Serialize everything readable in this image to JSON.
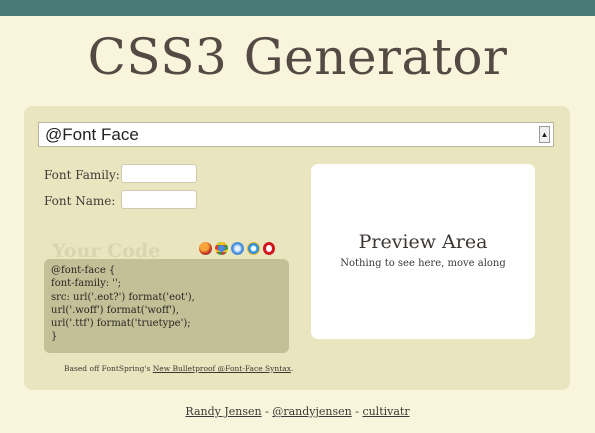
{
  "title": "CSS3 Generator",
  "selector": {
    "selected": "@Font Face"
  },
  "form": {
    "font_family_label": "Font Family:",
    "font_name_label": "Font Name:",
    "font_family_value": "",
    "font_name_value": ""
  },
  "code": {
    "heading": "Your Code",
    "browser_icons": [
      "firefox-icon",
      "chrome-icon",
      "safari-icon",
      "ie-icon",
      "opera-icon"
    ],
    "lines": [
      "@font-face {",
      "font-family: '';",
      "src: url('.eot?') format('eot'),",
      "url('.woff') format('woff'),",
      "url('.ttf') format('truetype');",
      "}"
    ]
  },
  "preview": {
    "title": "Preview Area",
    "subtitle": "Nothing to see here, move along"
  },
  "credit": {
    "prefix": "Based off FontSpring's ",
    "link": "New Bulletproof @Font-Face Syntax",
    "suffix": "."
  },
  "footer": {
    "author": "Randy Jensen",
    "sep1": " - ",
    "twitter": "@randyjensen",
    "sep2": " - ",
    "company": "cultivatr"
  },
  "colors": {
    "topbar": "#4a7a78",
    "background": "#f8f5dc",
    "panel": "#e9e5bf",
    "code_box": "#c3c098"
  }
}
